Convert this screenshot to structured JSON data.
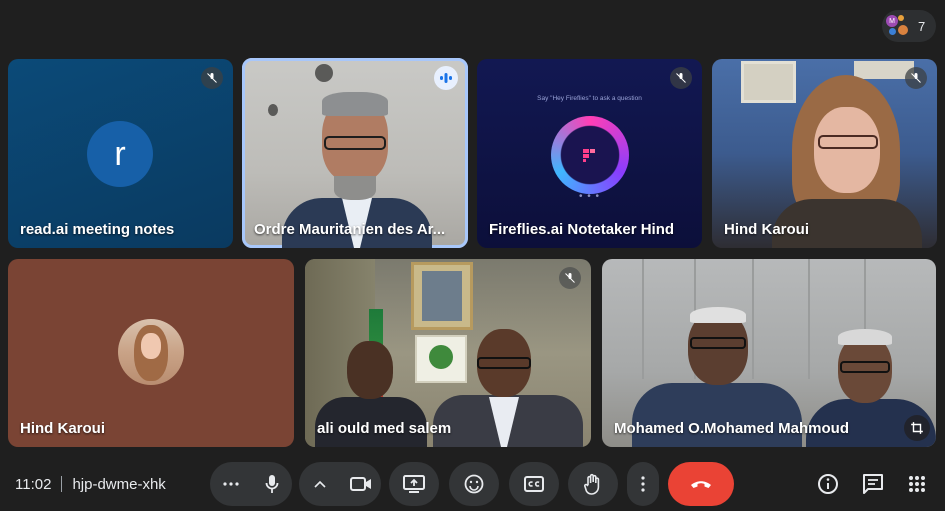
{
  "header": {
    "participant_count": "7",
    "mini_avatar_letter": "M"
  },
  "tiles": [
    {
      "name": "read.ai meeting notes",
      "avatar_letter": "r",
      "avatar_color": "#1760a8",
      "muted": true
    },
    {
      "name": "Ordre Mauritanien des Ar...",
      "speaking": true
    },
    {
      "name": "Fireflies.ai Notetaker Hind",
      "hint": "Say \"Hey Fireflies\" to ask a question",
      "dots": "• • •",
      "muted": true
    },
    {
      "name": "Hind Karoui",
      "muted": true
    },
    {
      "name": "Hind Karoui"
    },
    {
      "name": "ali ould med salem",
      "muted": true
    },
    {
      "name": "Mohamed O.Mohamed Mahmoud"
    }
  ],
  "bottom_bar": {
    "time": "11:02",
    "meeting_code": "hjp-dwme-xhk"
  },
  "colors": {
    "background": "#1f1f1f",
    "control_bg": "#333537",
    "hangup": "#ea4335",
    "speaking_outline": "#a8c7fa"
  },
  "icons": [
    "more-options-icon",
    "mic-icon",
    "chevron-up-icon",
    "camera-icon",
    "present-icon",
    "emoji-icon",
    "captions-icon",
    "raise-hand-icon",
    "more-vert-icon",
    "hangup-icon",
    "info-icon",
    "chat-icon",
    "activities-icon",
    "crop-icon",
    "mic-off-icon",
    "speaking-icon"
  ]
}
